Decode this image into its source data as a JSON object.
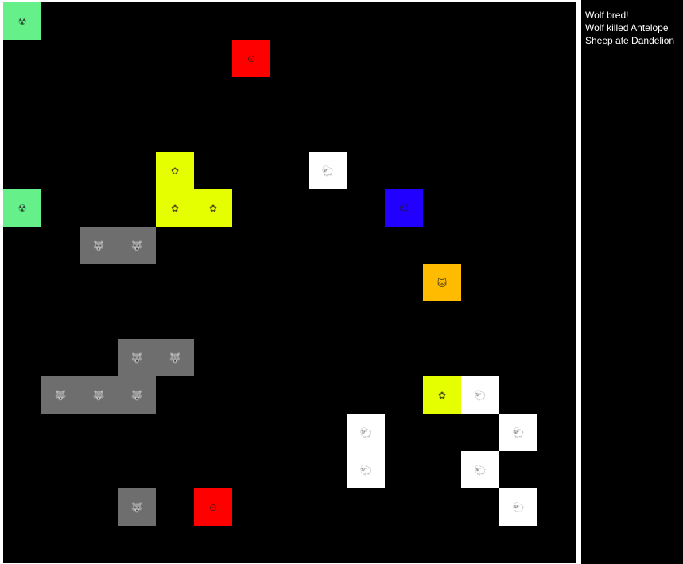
{
  "log": {
    "lines": [
      "Wolf bred!",
      "Wolf killed Antelope",
      "Sheep ate Dandelion"
    ]
  },
  "colors": {
    "board": "#000000",
    "guarana": "#66f08a",
    "belladonna": "#ff0000",
    "dandelion": "#e6ff00",
    "sheep": "#ffffff",
    "wolf": "#6e6e6e",
    "human": "#2200ff",
    "fox": "#ffbb00"
  },
  "icons": {
    "guarana": "radiation-icon",
    "belladonna": "circle-dot-icon",
    "dandelion": "flower-icon",
    "sheep": "sheep-icon",
    "wolf": "wolf-icon",
    "human": "human-icon",
    "fox": "fox-icon"
  },
  "grid": {
    "columns": 15,
    "rows": 15,
    "organisms": [
      {
        "type": "guarana",
        "col": 0,
        "row": 0
      },
      {
        "type": "belladonna",
        "col": 6,
        "row": 1
      },
      {
        "type": "dandelion",
        "col": 4,
        "row": 4
      },
      {
        "type": "sheep",
        "col": 8,
        "row": 4
      },
      {
        "type": "guarana",
        "col": 0,
        "row": 5
      },
      {
        "type": "dandelion",
        "col": 4,
        "row": 5
      },
      {
        "type": "dandelion",
        "col": 5,
        "row": 5
      },
      {
        "type": "human",
        "col": 10,
        "row": 5
      },
      {
        "type": "wolf",
        "col": 2,
        "row": 6
      },
      {
        "type": "wolf",
        "col": 3,
        "row": 6
      },
      {
        "type": "fox",
        "col": 11,
        "row": 7
      },
      {
        "type": "wolf",
        "col": 3,
        "row": 9
      },
      {
        "type": "wolf",
        "col": 4,
        "row": 9
      },
      {
        "type": "wolf",
        "col": 1,
        "row": 10
      },
      {
        "type": "wolf",
        "col": 2,
        "row": 10
      },
      {
        "type": "wolf",
        "col": 3,
        "row": 10
      },
      {
        "type": "dandelion",
        "col": 11,
        "row": 10
      },
      {
        "type": "sheep",
        "col": 12,
        "row": 10
      },
      {
        "type": "sheep",
        "col": 9,
        "row": 11
      },
      {
        "type": "sheep",
        "col": 13,
        "row": 11
      },
      {
        "type": "sheep",
        "col": 9,
        "row": 12
      },
      {
        "type": "sheep",
        "col": 12,
        "row": 12
      },
      {
        "type": "wolf",
        "col": 3,
        "row": 13
      },
      {
        "type": "belladonna",
        "col": 5,
        "row": 13
      },
      {
        "type": "sheep",
        "col": 13,
        "row": 13
      }
    ]
  }
}
